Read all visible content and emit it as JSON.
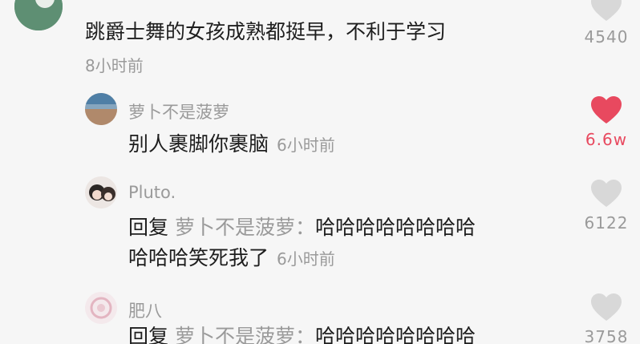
{
  "colors": {
    "background": "#f6f6f6",
    "text": "#1e1e1e",
    "secondary": "#9a9a9a",
    "like_active": "#e8495f",
    "like_inactive": "#d8d8d8"
  },
  "comments": [
    {
      "username": "",
      "text": "跳爵士舞的女孩成熟都挺早，不利于学习",
      "time": "8小时前",
      "likes": "4540",
      "liked": false,
      "like_icon": "heart-outline-icon"
    },
    {
      "username": "萝卜不是菠萝",
      "text": "别人裹脚你裹脑",
      "time": "6小时前",
      "likes": "6.6w",
      "liked": true,
      "like_icon": "heart-filled-icon"
    },
    {
      "username": "Pluto.",
      "reply_label": "回复",
      "reply_target": "萝卜不是菠萝：",
      "text_line1": "哈哈哈哈哈哈哈哈",
      "text_line2": "哈哈哈笑死我了",
      "time": "6小时前",
      "likes": "6122",
      "liked": false,
      "like_icon": "heart-outline-icon"
    },
    {
      "username": "肥八",
      "reply_label": "回复",
      "reply_target": "萝卜不是菠萝：",
      "text_line1": "哈哈哈哈哈哈哈哈",
      "likes": "3758",
      "liked": false,
      "like_icon": "heart-outline-icon"
    }
  ]
}
